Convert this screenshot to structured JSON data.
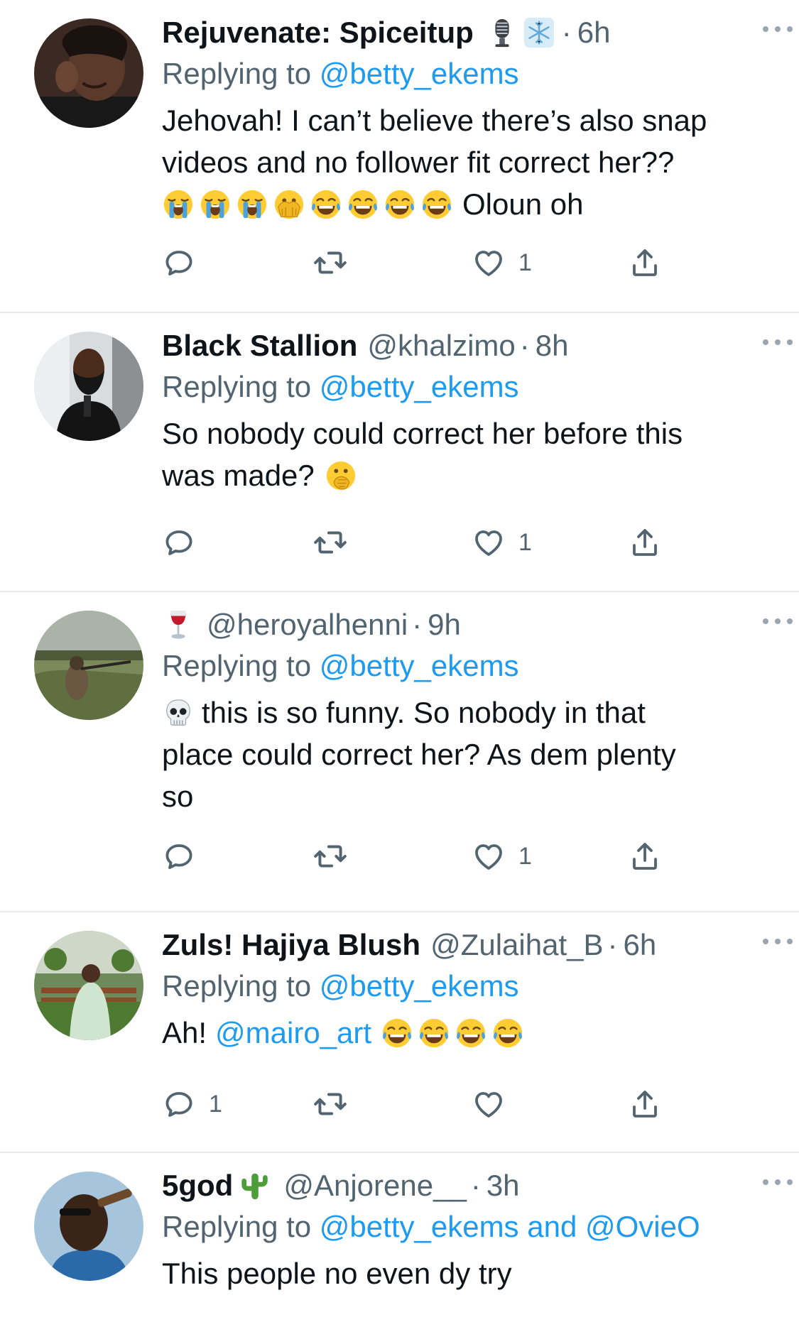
{
  "tweets": [
    {
      "name": "Rejuvenate: Spiceitup",
      "handle": "",
      "name_emojis": [
        "microphone",
        "snowflake"
      ],
      "time": "6h",
      "replying_label": "Replying to",
      "replying_to": "@betty_ekems",
      "body_line1": "Jehovah! I can’t believe there’s also snap",
      "body_line2": "videos and no follower fit correct her??",
      "body_emojis": [
        "loudly-crying-face",
        "loudly-crying-face",
        "loudly-crying-face",
        "face-with-open-eyes-and-hand-over-mouth",
        "face-with-tears-of-joy",
        "face-with-tears-of-joy",
        "face-with-tears-of-joy",
        "face-with-tears-of-joy"
      ],
      "body_tail": "Oloun oh",
      "reply_count": "",
      "retweet_count": "",
      "like_count": "1"
    },
    {
      "name": "Black Stallion",
      "handle": "@khalzimo",
      "time": "8h",
      "replying_label": "Replying to",
      "replying_to": "@betty_ekems",
      "body_line1": "So nobody could correct her before this",
      "body_line2": "was made?",
      "body_emojis": [
        "face-with-hand-over-mouth"
      ],
      "reply_count": "",
      "retweet_count": "",
      "like_count": "1"
    },
    {
      "name": "",
      "name_emojis": [
        "wine-glass"
      ],
      "handle": "@heroyalhenni",
      "time": "9h",
      "replying_label": "Replying to",
      "replying_to": "@betty_ekems",
      "body_emojis": [
        "skull"
      ],
      "body_line1": "this is so funny. So nobody in that",
      "body_line2": "place could correct her? As dem plenty",
      "body_line3": "so",
      "reply_count": "",
      "retweet_count": "",
      "like_count": "1"
    },
    {
      "name": "Zuls! Hajiya Blush",
      "handle": "@Zulaihat_B",
      "time": "6h",
      "replying_label": "Replying to",
      "replying_to": "@betty_ekems",
      "body_prefix": "Ah!",
      "body_mention": "@mairo_art",
      "body_emojis": [
        "face-with-tears-of-joy",
        "face-with-tears-of-joy",
        "face-with-tears-of-joy",
        "face-with-tears-of-joy"
      ],
      "reply_count": "1",
      "retweet_count": "",
      "like_count": ""
    },
    {
      "name": "5god",
      "name_emojis": [
        "cactus"
      ],
      "handle": "@Anjorene__",
      "time": "3h",
      "replying_label": "Replying to",
      "replying_to": "@betty_ekems",
      "replying_and": "and",
      "replying_to_2": "@OvieO",
      "body_line1": "This people no even dy try"
    }
  ],
  "separator_dot": "·",
  "colors": {
    "text": "#0f1419",
    "secondary": "#536471",
    "link": "#1d9bf0",
    "divider": "#e7e9ea"
  }
}
